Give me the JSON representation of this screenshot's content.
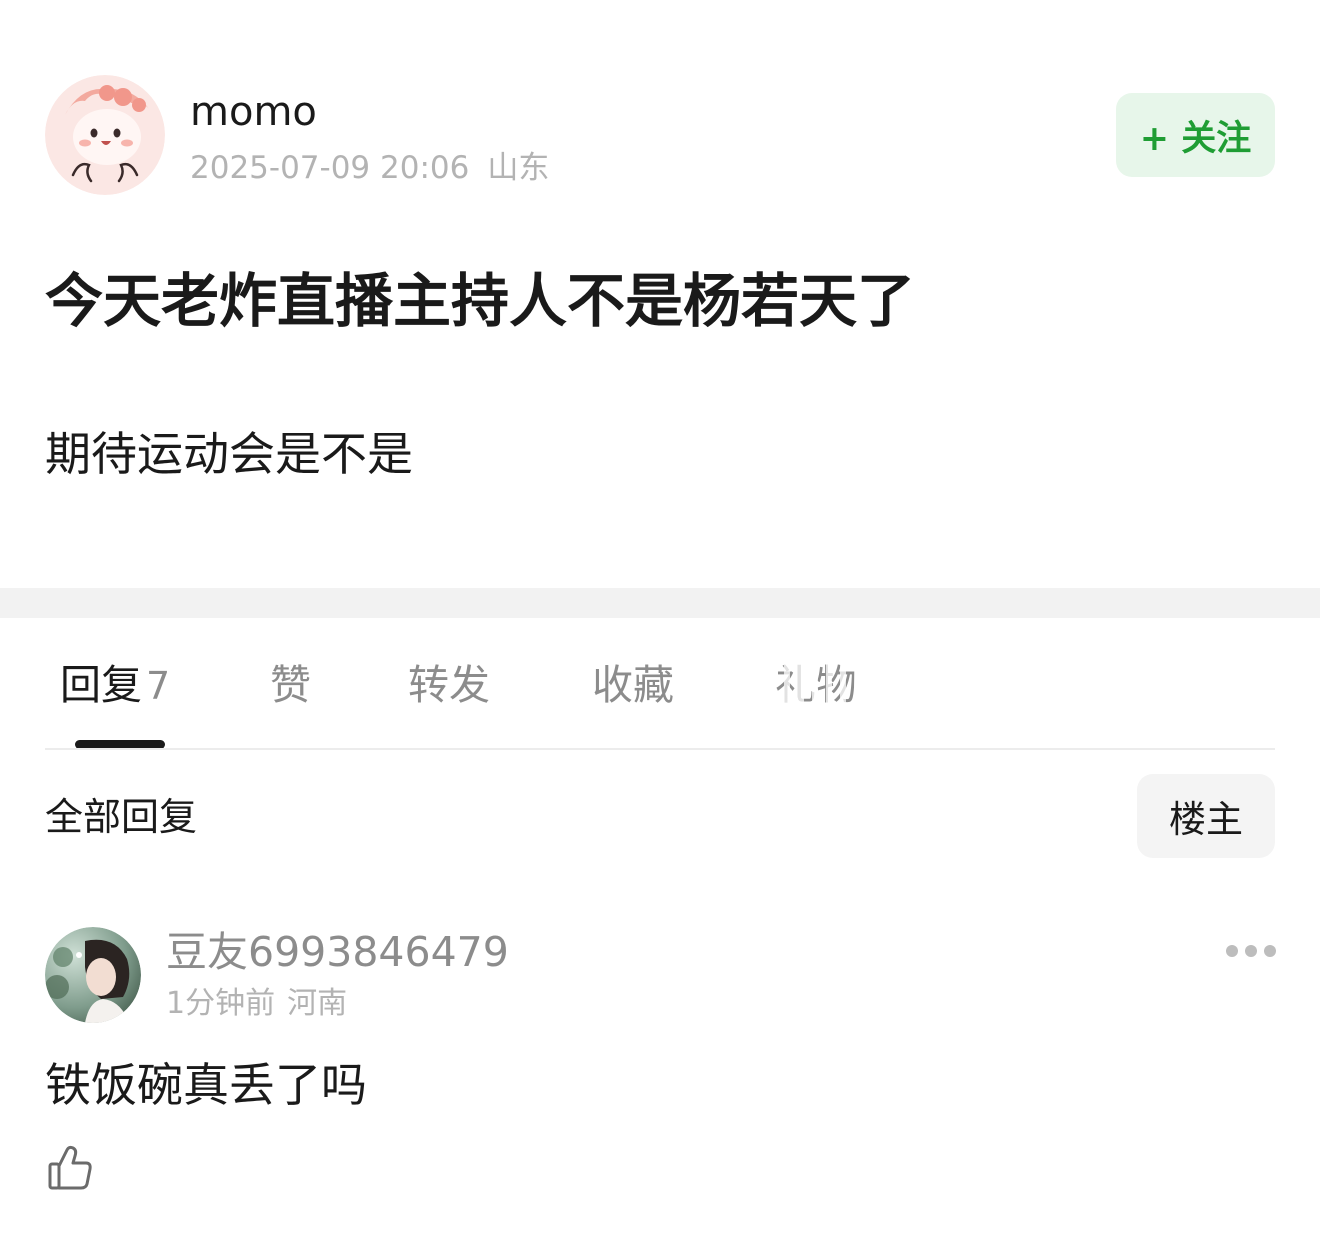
{
  "post": {
    "author": "momo",
    "date": "2025-07-09 20:06",
    "location": "山东",
    "follow_label": "+ 关注",
    "title": "今天老炸直播主持人不是杨若天了",
    "body": "期待运动会是不是"
  },
  "tabs": [
    {
      "label": "回复",
      "count": "7",
      "active": true
    },
    {
      "label": "赞"
    },
    {
      "label": "转发"
    },
    {
      "label": "收藏"
    },
    {
      "label": "礼物"
    }
  ],
  "replies_header": {
    "title": "全部回复",
    "filter_label": "楼主"
  },
  "reply": {
    "user": "豆友6993846479",
    "time": "1分钟前",
    "location": "河南",
    "text": "铁饭碗真丢了吗"
  },
  "icons": {
    "more": "more-dots-icon",
    "like": "thumbs-up-icon"
  },
  "colors": {
    "follow_accent": "#1f9d34",
    "follow_bg": "#e7f6ea",
    "muted_text": "#8c8c8c",
    "meta_text": "#b3b3b3"
  }
}
